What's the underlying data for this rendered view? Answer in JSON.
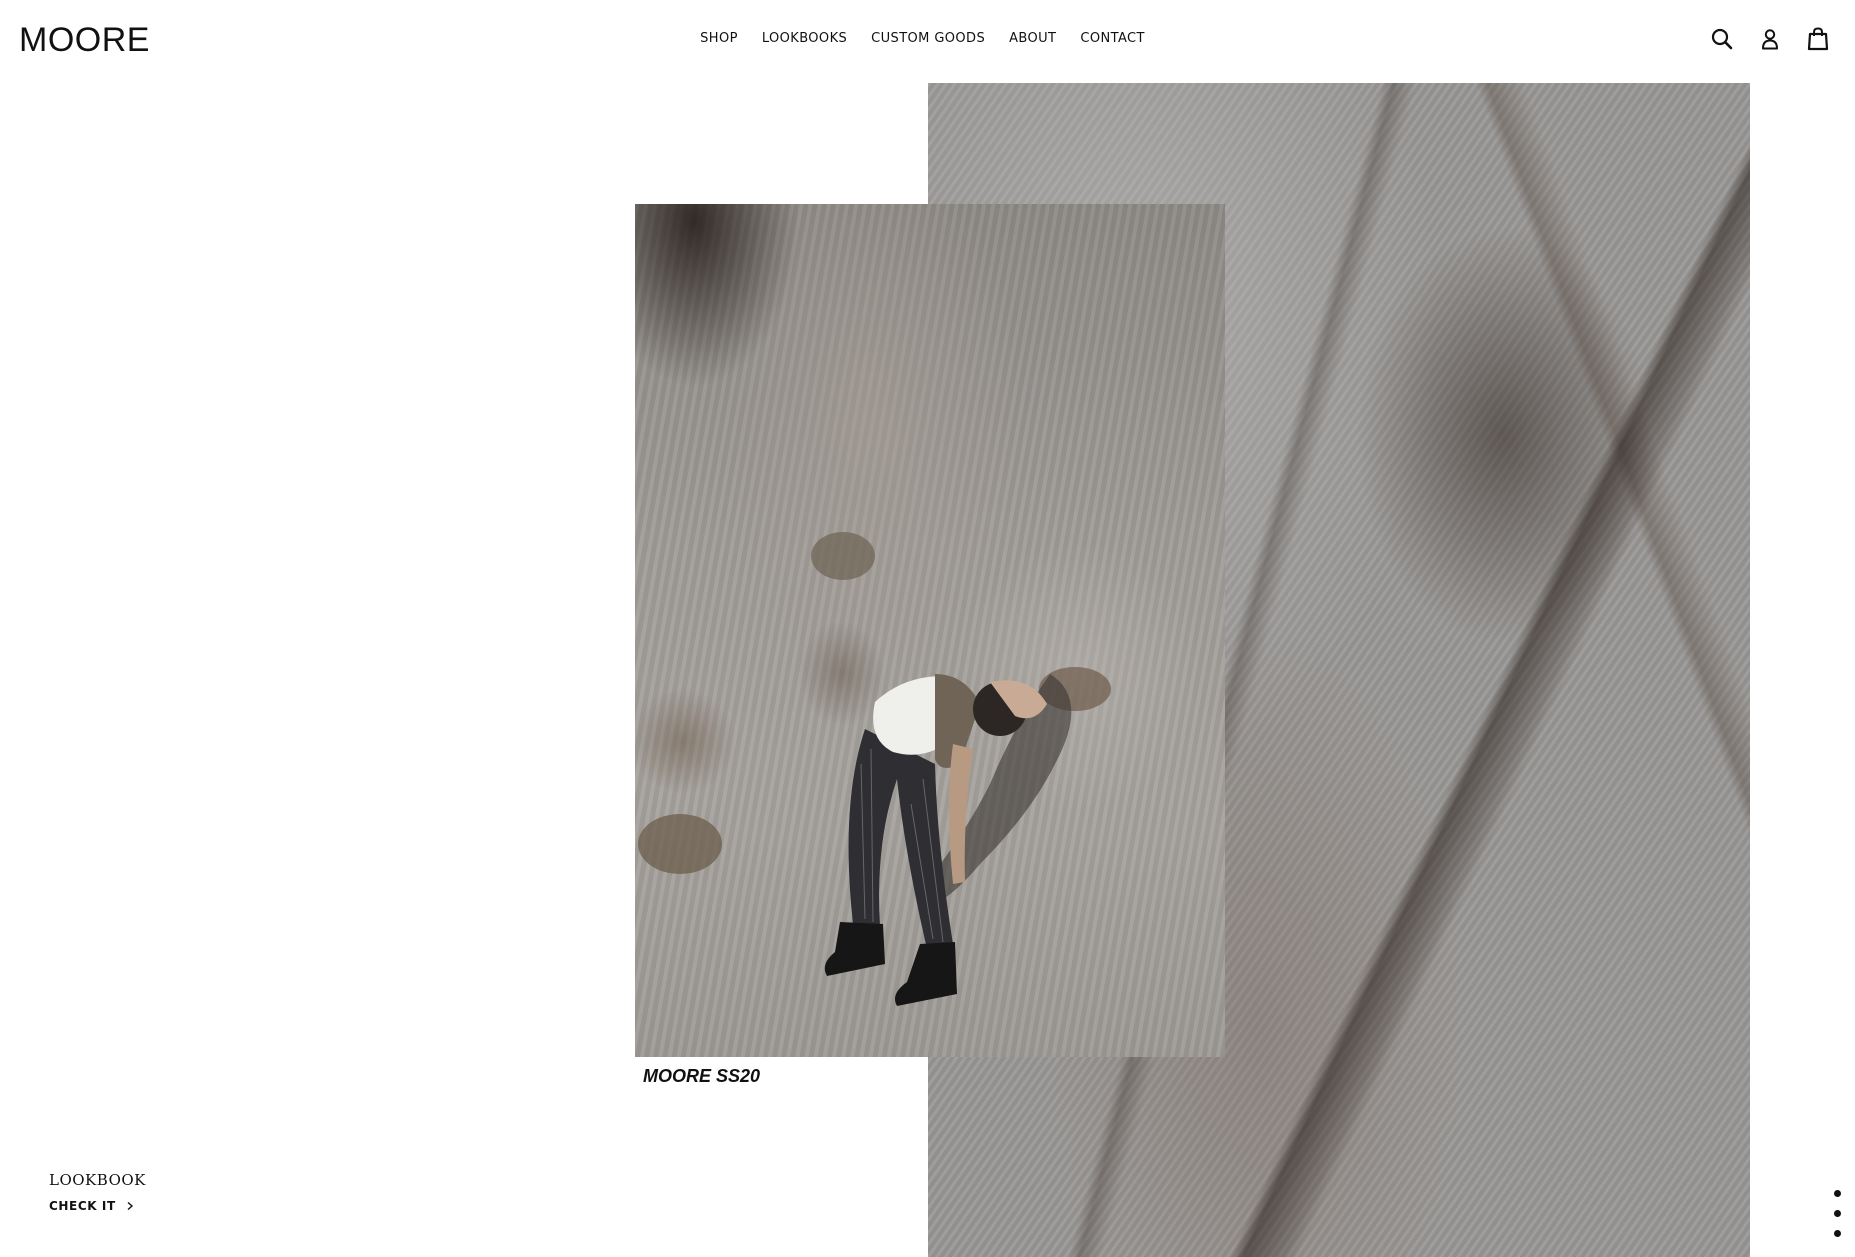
{
  "header": {
    "logo": "MOORE",
    "nav": [
      {
        "label": "SHOP"
      },
      {
        "label": "LOOKBOOKS"
      },
      {
        "label": "CUSTOM GOODS"
      },
      {
        "label": "ABOUT"
      },
      {
        "label": "CONTACT"
      }
    ],
    "icons": [
      "search-icon",
      "account-icon",
      "cart-icon"
    ]
  },
  "hero": {
    "caption": "MOORE SS20",
    "images": [
      "rock-cliff-photo",
      "model-on-rocks-photo"
    ]
  },
  "slide": {
    "title": "LOOKBOOK",
    "cta_label": "CHECK IT",
    "cta_icon": "chevron-right-icon"
  },
  "pagination": {
    "count": 3
  },
  "colors": {
    "text": "#111111",
    "background": "#ffffff",
    "rock": "#9a9896"
  }
}
